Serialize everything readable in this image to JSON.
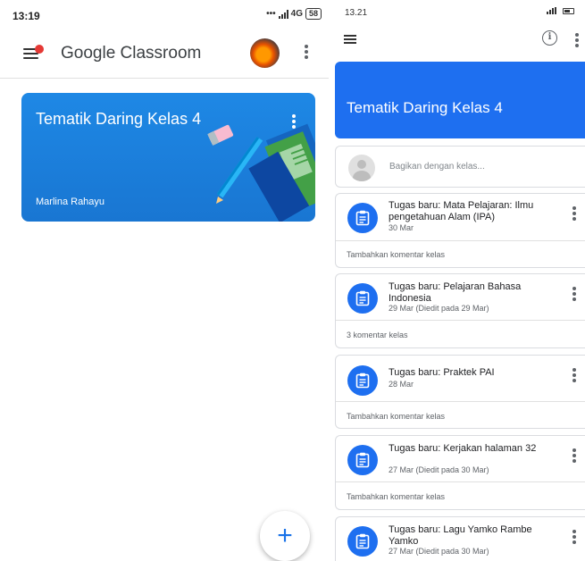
{
  "left": {
    "status": {
      "time": "13:19",
      "network": "4G",
      "battery": "58"
    },
    "appbar": {
      "title": "Google Classroom"
    },
    "class_card": {
      "title": "Tematik Daring Kelas 4",
      "teacher": "Marlina Rahayu"
    },
    "fab": {
      "label": "+"
    }
  },
  "right": {
    "status": {
      "time": "13.21"
    },
    "banner": {
      "title": "Tematik Daring Kelas 4"
    },
    "share": {
      "placeholder": "Bagikan dengan kelas..."
    },
    "posts": [
      {
        "title": "Tugas baru: Mata Pelajaran: Ilmu pengetahuan Alam (IPA)",
        "date": "30 Mar",
        "comment": "Tambahkan komentar kelas"
      },
      {
        "title": "Tugas baru: Pelajaran Bahasa Indonesia",
        "date": "29 Mar (Diedit pada 29 Mar)",
        "comment": "3 komentar kelas"
      },
      {
        "title": "Tugas baru: Praktek PAI",
        "date": "28 Mar",
        "comment": "Tambahkan komentar kelas"
      },
      {
        "title": "Tugas baru: Kerjakan halaman 32",
        "date": "27 Mar (Diedit pada 30 Mar)",
        "comment": "Tambahkan komentar kelas"
      },
      {
        "title": "Tugas baru: Lagu Yamko Rambe Yamko",
        "date": "27 Mar (Diedit pada 30 Mar)",
        "comment": ""
      }
    ]
  },
  "colors": {
    "accent": "#1e6ff0",
    "card": "#1976d2",
    "notification": "#e53935"
  }
}
